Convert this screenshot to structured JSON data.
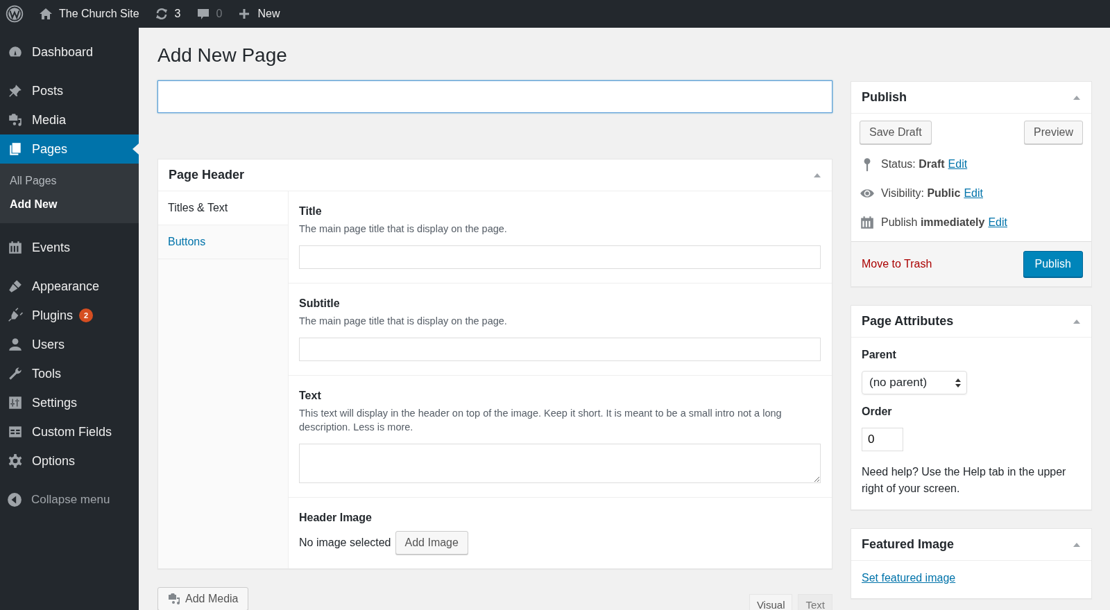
{
  "admin_bar": {
    "site": "The Church Site",
    "updates": "3",
    "comments": "0",
    "new": "New"
  },
  "sidebar": {
    "groups": [
      [
        {
          "label": "Dashboard",
          "selected": false
        }
      ],
      [
        {
          "label": "Posts",
          "selected": false
        },
        {
          "label": "Media",
          "selected": false
        },
        {
          "label": "Pages",
          "selected": true,
          "children": [
            {
              "label": "All Pages",
              "selected": false
            },
            {
              "label": "Add New",
              "selected": true
            }
          ]
        }
      ],
      [
        {
          "label": "Events",
          "selected": false
        }
      ],
      [
        {
          "label": "Appearance",
          "selected": false
        },
        {
          "label": "Plugins",
          "selected": false,
          "badge": "2"
        },
        {
          "label": "Users",
          "selected": false
        },
        {
          "label": "Tools",
          "selected": false
        },
        {
          "label": "Settings",
          "selected": false
        },
        {
          "label": "Custom Fields",
          "selected": false
        },
        {
          "label": "Options",
          "selected": false
        }
      ]
    ],
    "collapse": "Collapse menu"
  },
  "page_title": "Add New Page",
  "title_field": {
    "focused": true
  },
  "page_header": {
    "title": "Page Header",
    "tabs": [
      {
        "label": "Titles & Text",
        "selected": true
      },
      {
        "label": "Buttons",
        "selected": false
      }
    ],
    "fields": [
      {
        "kind": "input",
        "label": "Title",
        "description": "The main page title that is display on the page."
      },
      {
        "kind": "input",
        "label": "Subtitle",
        "description": "The main page title that is display on the page."
      },
      {
        "kind": "textarea",
        "label": "Text",
        "description": "This text will display in the header on top of the image. Keep it short. It is meant to be a small intro not a long description. Less is more."
      },
      {
        "kind": "image",
        "label": "Header Image",
        "status": "No image selected",
        "button": "Add Image"
      }
    ]
  },
  "editor": {
    "add_media": "Add Media",
    "tabs": [
      {
        "label": "Visual",
        "selected": true
      },
      {
        "label": "Text",
        "selected": false
      }
    ]
  },
  "publish": {
    "title": "Publish",
    "save_draft": "Save Draft",
    "preview": "Preview",
    "rows": [
      {
        "text": "Status: **Draft**",
        "link": "Edit"
      },
      {
        "text": "Visibility: **Public**",
        "link": "Edit"
      },
      {
        "text": "Publish **immediately**",
        "link": "Edit"
      }
    ],
    "trash": "Move to Trash",
    "publish_button": "Publish"
  },
  "page_attributes": {
    "title": "Page Attributes",
    "parent_label": "Parent",
    "parent_value": "(no parent)",
    "order_label": "Order",
    "order_value": "0",
    "help": "Need help? Use the Help tab in the upper right of your screen."
  },
  "featured_image": {
    "title": "Featured Image",
    "link": "Set featured image"
  }
}
